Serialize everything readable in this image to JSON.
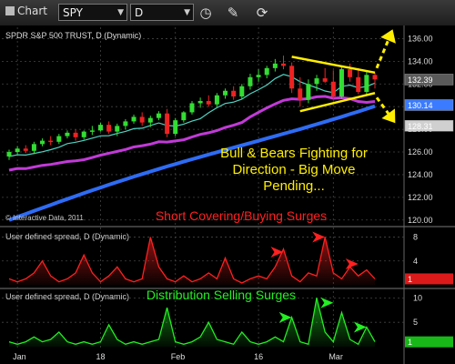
{
  "toolbar": {
    "title": "Chart",
    "symbol": "SPY",
    "interval": "D",
    "icons": [
      "chart-icon",
      "dropdown-icon",
      "clock-icon",
      "pencil-icon",
      "refresh-icon"
    ]
  },
  "chart_data": [
    {
      "type": "candlestick",
      "title": "SPDR S&P 500 TRUST, D (Dynamic)",
      "copyright": "© Interactive Data, 2011",
      "ylim": [
        119.5,
        137
      ],
      "y_ticks": [
        "136.00",
        "134.00",
        "132.00",
        "130.00",
        "128.00",
        "126.00",
        "124.00",
        "122.00",
        "120.00"
      ],
      "x_ticks": [
        "Jan",
        "18",
        "Feb",
        "16",
        "Mar"
      ],
      "price_labels": [
        {
          "value": "132.39",
          "color": "#ffffff"
        },
        {
          "value": "130.14",
          "color": "#3a7bff"
        },
        {
          "value": "128.31",
          "color": "#d0d0d0"
        }
      ],
      "ohlc": [
        [
          125.6,
          126.2,
          125.3,
          126.0
        ],
        [
          126.0,
          126.5,
          125.7,
          126.3
        ],
        [
          126.3,
          126.6,
          125.9,
          126.1
        ],
        [
          126.1,
          126.9,
          125.8,
          126.7
        ],
        [
          126.7,
          127.2,
          126.5,
          127.0
        ],
        [
          127.0,
          127.4,
          126.6,
          126.9
        ],
        [
          126.9,
          127.6,
          126.7,
          127.4
        ],
        [
          127.4,
          127.9,
          127.2,
          127.7
        ],
        [
          127.7,
          128.0,
          127.0,
          127.3
        ],
        [
          127.3,
          127.9,
          127.1,
          127.8
        ],
        [
          127.8,
          128.3,
          127.5,
          127.9
        ],
        [
          127.9,
          128.6,
          127.8,
          128.4
        ],
        [
          128.4,
          128.7,
          127.6,
          127.8
        ],
        [
          127.8,
          128.5,
          127.4,
          128.3
        ],
        [
          128.3,
          128.9,
          128.0,
          128.7
        ],
        [
          128.7,
          129.3,
          128.5,
          129.1
        ],
        [
          129.1,
          129.5,
          128.3,
          128.6
        ],
        [
          128.6,
          129.2,
          128.2,
          129.0
        ],
        [
          129.0,
          129.6,
          128.8,
          129.4
        ],
        [
          129.4,
          129.8,
          127.3,
          127.6
        ],
        [
          127.6,
          129.0,
          127.4,
          128.8
        ],
        [
          128.8,
          129.6,
          128.6,
          129.5
        ],
        [
          129.5,
          130.5,
          129.3,
          130.3
        ],
        [
          130.3,
          130.8,
          129.9,
          130.5
        ],
        [
          130.5,
          131.0,
          130.0,
          130.2
        ],
        [
          130.2,
          131.2,
          130.0,
          131.0
        ],
        [
          131.0,
          131.6,
          130.7,
          131.4
        ],
        [
          131.4,
          131.8,
          130.6,
          130.9
        ],
        [
          130.9,
          132.0,
          130.7,
          131.8
        ],
        [
          131.8,
          132.9,
          131.5,
          132.6
        ],
        [
          132.6,
          133.3,
          132.2,
          132.8
        ],
        [
          132.8,
          133.6,
          132.5,
          133.4
        ],
        [
          133.4,
          134.2,
          133.1,
          133.8
        ],
        [
          133.8,
          134.5,
          133.3,
          133.6
        ],
        [
          133.6,
          133.9,
          131.2,
          131.6
        ],
        [
          131.6,
          132.6,
          130.0,
          130.6
        ],
        [
          130.6,
          132.4,
          130.3,
          132.0
        ],
        [
          132.0,
          132.8,
          131.4,
          132.5
        ],
        [
          132.5,
          133.4,
          132.1,
          132.2
        ],
        [
          132.2,
          133.2,
          130.6,
          130.9
        ],
        [
          130.9,
          133.6,
          130.7,
          133.3
        ],
        [
          133.3,
          133.8,
          132.2,
          132.6
        ],
        [
          132.6,
          133.4,
          131.1,
          131.3
        ],
        [
          131.3,
          133.1,
          131.0,
          132.8
        ],
        [
          132.8,
          133.0,
          131.6,
          132.4
        ]
      ],
      "ma_fast_color": "#4fd2c2",
      "ma_mid_color": "#c23ad8",
      "ma_slow_color": "#2e6cf5",
      "trendline_color": "#ffee00",
      "annotation": {
        "lines": [
          "Bull  & Bears Fighting for",
          "Direction - Big Move",
          "Pending..."
        ],
        "color": "#ffee00"
      }
    },
    {
      "type": "area",
      "title": "User defined spread, D (Dynamic)",
      "annotation": "Short Covering/Buying Surges",
      "annotation_color": "#ff2020",
      "color": "#ff2020",
      "ylim": [
        0,
        9
      ],
      "y_ticks": [
        "8",
        "4"
      ],
      "last_value": "1",
      "values": [
        1,
        0.5,
        1,
        2,
        4,
        1.5,
        0.5,
        1,
        2,
        5,
        2,
        0.5,
        1.5,
        3,
        1,
        0.5,
        1,
        8,
        3,
        1,
        0.5,
        1.5,
        0.5,
        1,
        2,
        1,
        4.5,
        1,
        0.3,
        1,
        1.5,
        1,
        3,
        6,
        1.5,
        0.5,
        2,
        1.5,
        8,
        2,
        1,
        3,
        1.5,
        2.5,
        1
      ]
    },
    {
      "type": "area",
      "title": "User defined spread, D (Dynamic)",
      "annotation": "Distribution Selling Surges",
      "annotation_color": "#22ee22",
      "color": "#22ee22",
      "ylim": [
        0,
        11
      ],
      "y_ticks": [
        "10",
        "5"
      ],
      "last_value": "1",
      "values": [
        1,
        0.5,
        1,
        2,
        1,
        1.5,
        3,
        1,
        0.5,
        1,
        0.5,
        1,
        4.5,
        1.5,
        0.5,
        1,
        0.5,
        1,
        1.5,
        8,
        1,
        0.5,
        1,
        2,
        5,
        1.5,
        1,
        0.5,
        3,
        1,
        0.5,
        1,
        2,
        1,
        6,
        1,
        0.5,
        10,
        3,
        1,
        7,
        1.5,
        0.5,
        4,
        1
      ]
    }
  ]
}
